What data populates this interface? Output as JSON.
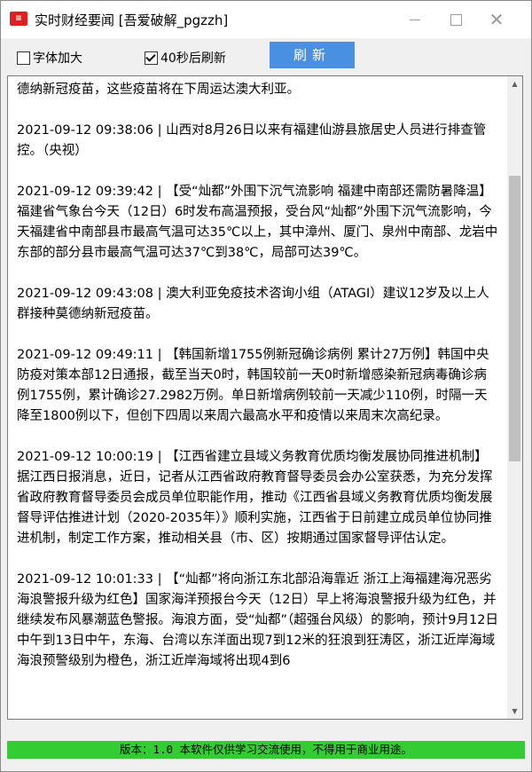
{
  "window": {
    "title": "实时财经要闻 [吾爱破解_pgzzh]",
    "icon": "news-app-icon",
    "controls": {
      "minimize": "minimize-icon",
      "maximize": "maximize-icon",
      "close": "close-icon"
    }
  },
  "toolbar": {
    "font_enlarge": {
      "label": "字体加大",
      "checked": false
    },
    "auto_refresh": {
      "label": "40秒后刷新",
      "checked": true
    },
    "refresh_button": "刷新"
  },
  "news": [
    "德纳新冠疫苗，这些疫苗将在下周运达澳大利亚。",
    "2021-09-12 09:38:06 |   山西对8月26日以来有福建仙游县旅居史人员进行排查管控。（央视）",
    "2021-09-12 09:39:42 | 【受“灿都”外围下沉气流影响 福建中南部还需防暑降温】福建省气象台今天（12日）6时发布高温预报，受台风“灿都”外围下沉气流影响，今天福建省中南部县市最高气温可达35℃以上，其中漳州、厦门、泉州中南部、龙岩中东部的部分县市最高气温可达37℃到38℃，局部可达39℃。",
    "2021-09-12 09:43:08 | 澳大利亚免疫技术咨询小组（ATAGI）建议12岁及以上人群接种莫德纳新冠疫苗。",
    "2021-09-12 09:49:11 |   【韩国新增1755例新冠确诊病例 累计27万例】韩国中央防疫对策本部12日通报，截至当天0时，韩国较前一天0时新增感染新冠病毒确诊病例1755例，累计确诊27.2982万例。单日新增病例较前一天减少110例，时隔一天降至1800例以下，但创下四周以来周六最高水平和疫情以来周末次高纪录。",
    "2021-09-12 10:00:19 | 【江西省建立县域义务教育优质均衡发展协同推进机制】据江西日报消息，近日，记者从江西省政府教育督导委员会办公室获悉，为充分发挥省政府教育督导委员会成员单位职能作用，推动《江西省县域义务教育优质均衡发展督导评估推进计划（2020-2035年）》顺利实施，江西省于日前建立成员单位协同推进机制，制定工作方案，推动相关县（市、区）按期通过国家督导评估认定。",
    "2021-09-12 10:01:33 | 【“灿都”将向浙江东北部沿海靠近 浙江上海福建海况恶劣 海浪警报升级为红色】国家海洋预报台今天（12日）早上将海浪警报升级为红色，并继续发布风暴潮蓝色警报。海浪方面，受“灿都”（超强台风级）的影响，预计9月12日中午到13日中午，东海、台湾以东洋面出现7到12米的狂浪到狂涛区，浙江近岸海域海浪预警级别为橙色，浙江近岸海域将出现4到6"
  ],
  "status": "版本：1.0     本软件仅供学习交流使用，不得用于商业用途。",
  "colors": {
    "refresh_button": "#4a90e2",
    "status_bar": "#33cc33",
    "app_icon": "#e02020"
  }
}
